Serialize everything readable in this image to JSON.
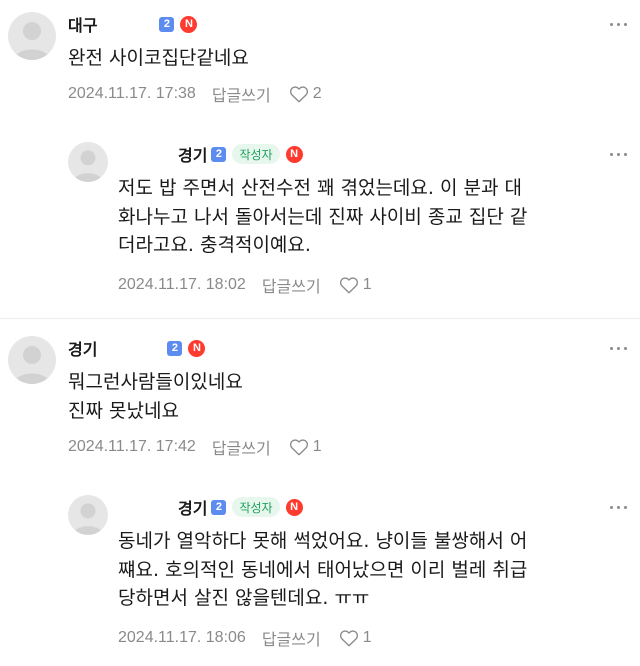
{
  "comments": [
    {
      "author": "대구",
      "level_badge": "2",
      "n_badge": "N",
      "text": "완전 사이코집단같네요",
      "date": "2024.11.17. 17:38",
      "reply_label": "답글쓰기",
      "likes": "2"
    },
    {
      "author": "경기",
      "level_badge": "2",
      "writer_badge": "작성자",
      "n_badge": "N",
      "text": "저도 밥 주면서 산전수전 꽤 겪었는데요. 이 분과 대\n화나누고 나서 돌아서는데 진짜 사이비 종교 집단 같\n더라고요. 충격적이예요.",
      "date": "2024.11.17. 18:02",
      "reply_label": "답글쓰기",
      "likes": "1"
    },
    {
      "author": "경기",
      "level_badge": "2",
      "n_badge": "N",
      "text": "뭐그런사람들이있네요\n진짜 못났네요",
      "date": "2024.11.17. 17:42",
      "reply_label": "답글쓰기",
      "likes": "1"
    },
    {
      "author": "경기",
      "level_badge": "2",
      "writer_badge": "작성자",
      "n_badge": "N",
      "text": "동네가 열악하다 못해 썩었어요. 냥이들 불쌍해서 어\n쨰요. 호의적인 동네에서 태어났으면 이리 벌레 취급\n당하면서 살진 않을텐데요. ㅠㅠ",
      "date": "2024.11.17. 18:06",
      "reply_label": "답글쓰기",
      "likes": "1"
    }
  ],
  "icons": {
    "avatar": "default-profile-icon",
    "like": "heart-outline-icon",
    "more": "more-options-icon"
  },
  "colors": {
    "level_badge": "#5d8cf0",
    "n_badge": "#ff3b30",
    "writer_badge_bg": "#e7f7ee",
    "writer_badge_text": "#1fa05a",
    "meta_text": "#8a8a8a"
  }
}
